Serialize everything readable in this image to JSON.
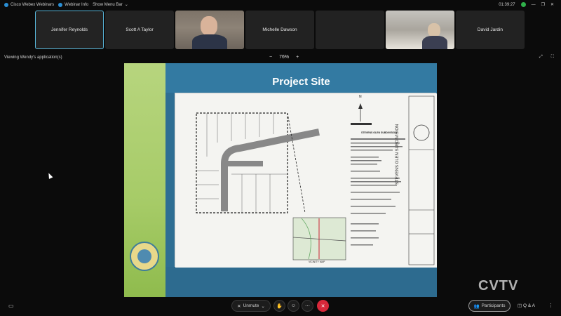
{
  "topbar": {
    "app_name": "Cisco Webex Webinars",
    "webinar_info": "Webinar Info",
    "show_menu": "Show Menu Bar",
    "time": "01:39:27"
  },
  "participants_strip": [
    {
      "name": "Jennifer Reynolds",
      "active": true
    },
    {
      "name": "Scott A Taylor"
    },
    {
      "name": ""
    },
    {
      "name": "Michelle Dawson"
    },
    {
      "name": ""
    },
    {
      "name": ""
    },
    {
      "name": "David Jardin"
    }
  ],
  "share": {
    "label": "Viewing Wendy's application(s)",
    "zoom_minus": "−",
    "zoom_value": "76%",
    "zoom_plus": "+"
  },
  "slide": {
    "title": "Project Site",
    "plan_labels": {
      "subdivision": "STEVENS GLEN SUBDIVISION",
      "side_title": "STEVENS GLEN SUBDIVISION",
      "vicinity": "VICINITY MAP",
      "north": "N"
    }
  },
  "controls": {
    "unmute": "Unmute",
    "participants": "Participants",
    "qa": "Q & A"
  },
  "watermark": "CVTV",
  "colors": {
    "accent_border": "#58b5d9",
    "end_call": "#d8283a",
    "slide_blue": "#337aa2",
    "slide_green": "#a6cb67"
  }
}
